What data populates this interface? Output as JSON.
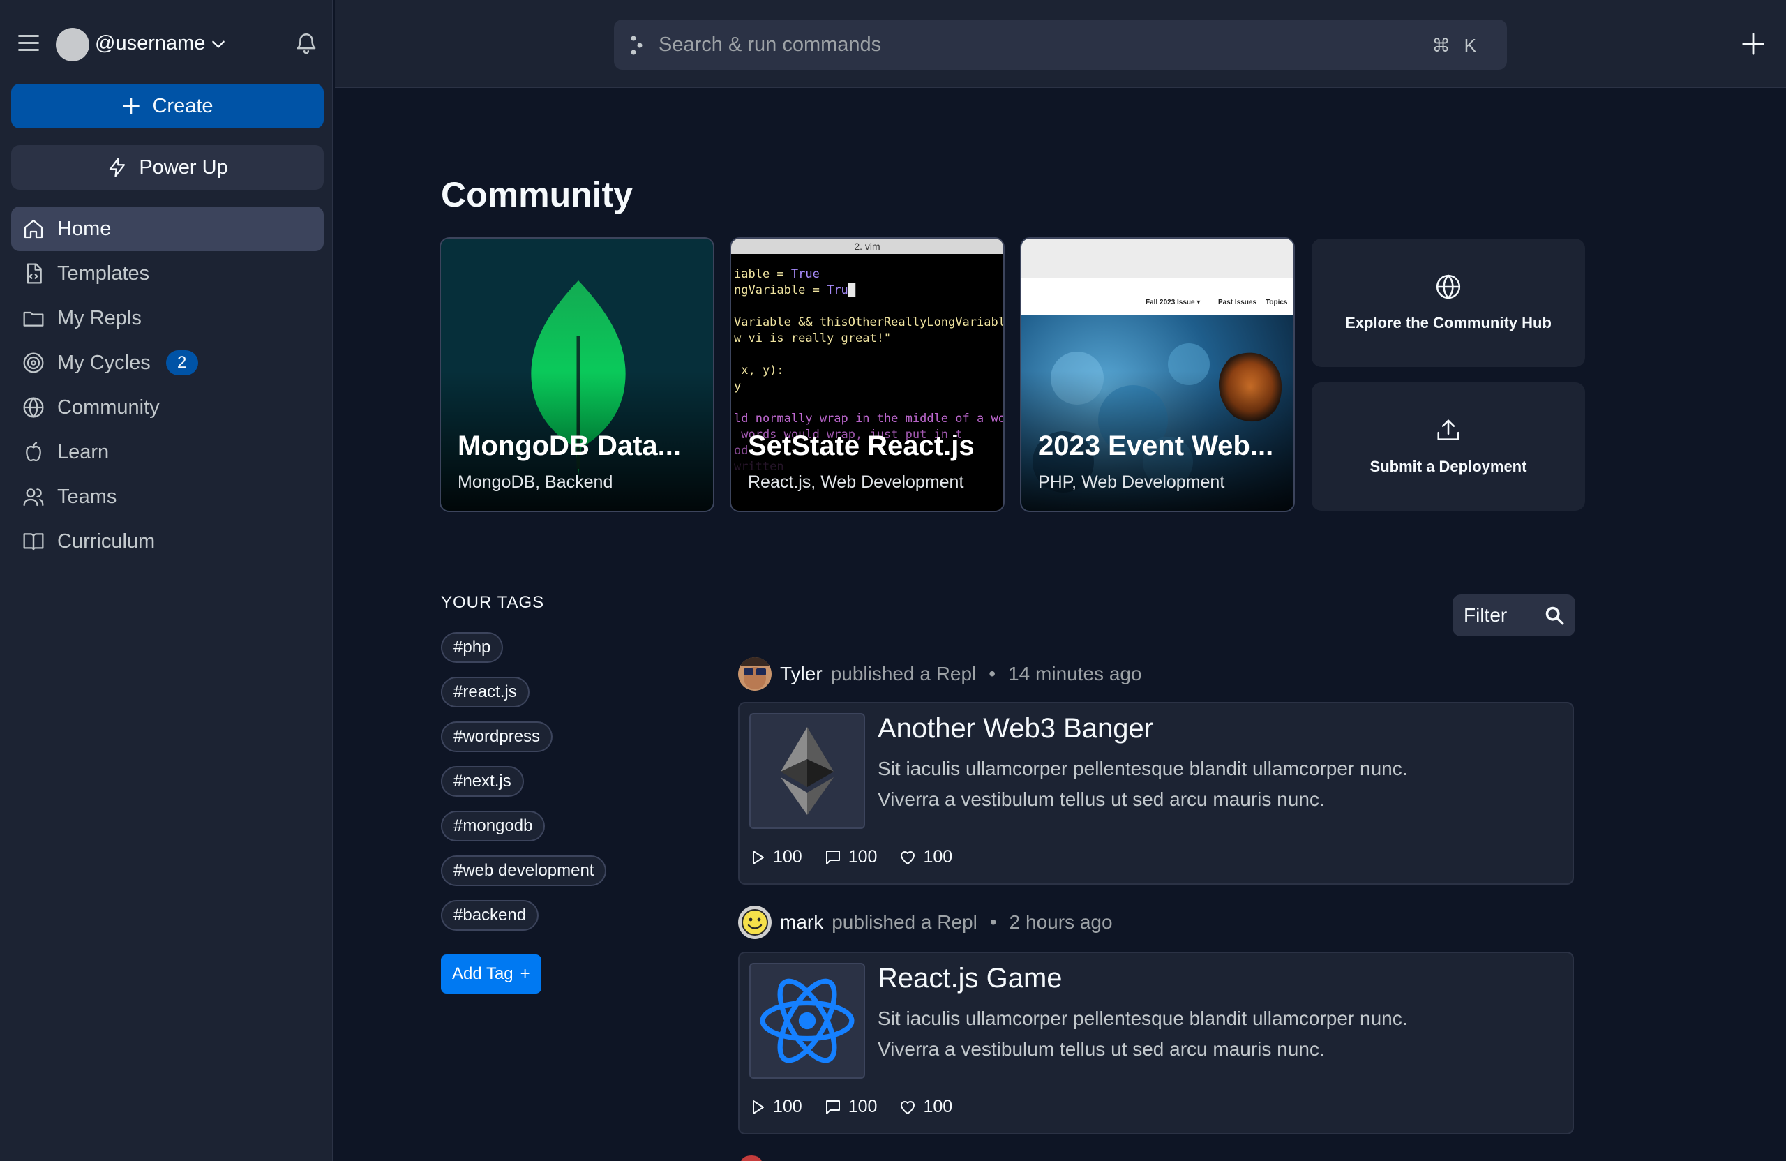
{
  "sidebar": {
    "username": "@username",
    "create_label": "Create",
    "power_label": "Power Up",
    "items": [
      {
        "label": "Home"
      },
      {
        "label": "Templates"
      },
      {
        "label": "My Repls"
      },
      {
        "label": "My Cycles",
        "badge": "2"
      },
      {
        "label": "Community"
      },
      {
        "label": "Learn"
      },
      {
        "label": "Teams"
      },
      {
        "label": "Curriculum"
      }
    ]
  },
  "topbar": {
    "search_placeholder": "Search & run commands",
    "shortcut": "⌘K"
  },
  "community": {
    "heading": "Community",
    "cards": [
      {
        "title": "MongoDB Data...",
        "subtitle": "MongoDB, Backend"
      },
      {
        "title": "SetState React.js",
        "subtitle": "React.js, Web Development",
        "window_title": "2. vim"
      },
      {
        "title": "2023 Event Web...",
        "subtitle": "PHP, Web Development",
        "site_nav": [
          "Fall 2023 Issue ▾",
          "Past Issues",
          "Topics"
        ]
      }
    ],
    "actions": [
      {
        "label": "Explore the Community Hub",
        "icon": "globe-icon"
      },
      {
        "label": "Submit a Deployment",
        "icon": "upload-icon"
      }
    ]
  },
  "tags": {
    "heading": "YOUR TAGS",
    "items": [
      "#php",
      "#react.js",
      "#wordpress",
      "#next.js",
      "#mongodb",
      "#web development",
      "#backend"
    ],
    "add_label": "Add Tag",
    "add_symbol": "+"
  },
  "feed": {
    "filter_label": "Filter",
    "posts": [
      {
        "author": "Tyler",
        "action": "published a Repl",
        "time": "14 minutes ago",
        "title": "Another Web3 Banger",
        "description": "Sit iaculis ullamcorper pellentesque blandit ullamcorper nunc. Viverra a vestibulum tellus ut sed arcu mauris nunc.",
        "runs": "100",
        "comments": "100",
        "likes": "100"
      },
      {
        "author": "mark",
        "action": "published a Repl",
        "time": "2 hours ago",
        "title": "React.js Game",
        "description": "Sit iaculis ullamcorper pellentesque blandit ullamcorper nunc. Viverra a vestibulum tellus ut sed arcu mauris nunc.",
        "runs": "100",
        "comments": "100",
        "likes": "100"
      }
    ]
  },
  "colors": {
    "background": "#0e1525",
    "surface": "#1c2333",
    "primary": "#0053a6",
    "accent": "#0079f2"
  }
}
